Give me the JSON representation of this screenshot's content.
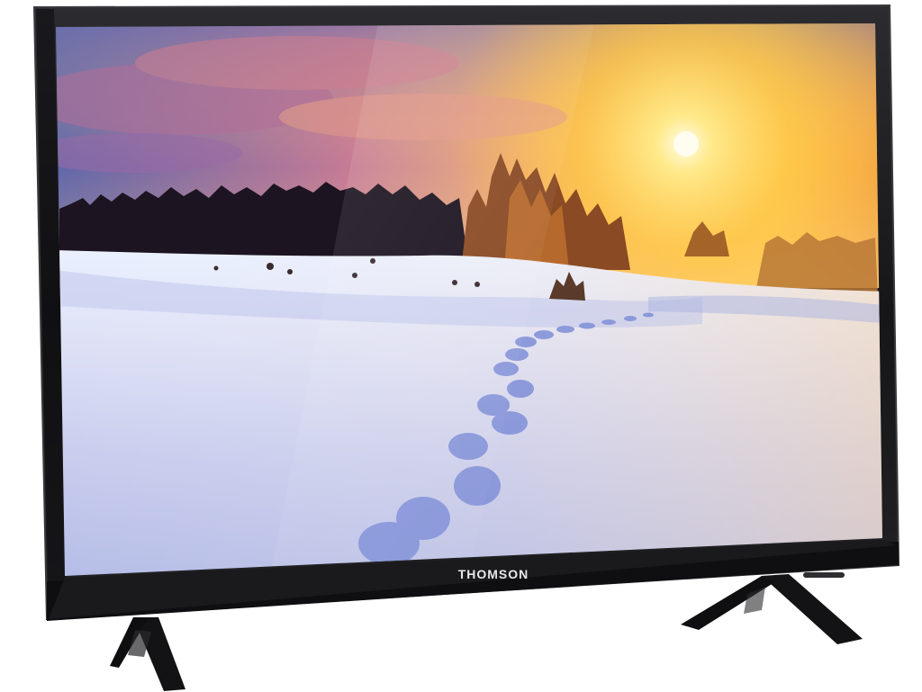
{
  "product": {
    "brand_label": "THOMSON"
  },
  "scene": {
    "subject": "snowy-landscape-sunset",
    "colors": {
      "sky_top": "#6f78b8",
      "sky_mid": "#d77a8a",
      "sun_glow": "#ffd24a",
      "sun_core": "#fffbe6",
      "snow_light": "#e9eaf7",
      "snow_shadow": "#9aa6dc",
      "tree_dark": "#1c1420",
      "tree_lit": "#b7662a"
    }
  },
  "device": {
    "colors": {
      "bezel": "#1b1b1d",
      "bezel_edge": "#3a3a3e",
      "stand": "#121214"
    }
  }
}
